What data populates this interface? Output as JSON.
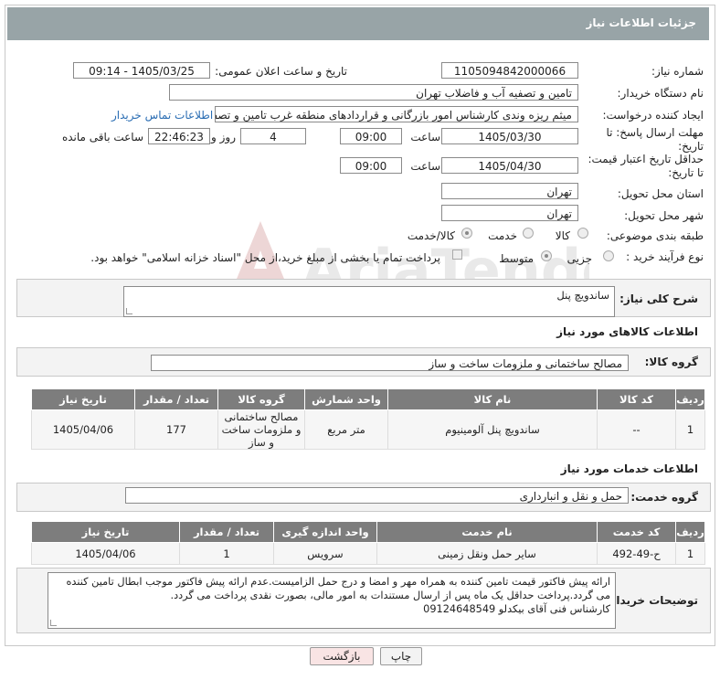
{
  "header": {
    "title": "جزئیات اطلاعات نیاز"
  },
  "fields": {
    "need_number_label": "شماره نیاز:",
    "need_number": "1105094842000066",
    "announce_label": "تاریخ و ساعت اعلان عمومی:",
    "announce_value": "1405/03/25 - 09:14",
    "buyer_org_label": "نام دستگاه خریدار:",
    "buyer_org": "تامین و تصفیه آب و فاضلاب تهران",
    "requester_label": "ایجاد کننده درخواست:",
    "requester": "میثم ریزه وندی کارشناس امور بازرگانی و قراردادهای منطقه غرب تامین و تصفیه",
    "contact_link": "اطلاعات تماس خریدار",
    "deadline_label": "مهلت ارسال پاسخ: تا تاریخ:",
    "deadline_date": "1405/03/30",
    "time_label": "ساعت",
    "deadline_time": "09:00",
    "days": "4",
    "days_label": "روز و",
    "remaining_time": "22:46:23",
    "remaining_label": "ساعت باقی مانده",
    "validity_label": "حداقل تاریخ اعتبار قیمت: تا تاریخ:",
    "validity_date": "1405/04/30",
    "validity_time": "09:00",
    "province_label": "استان محل تحویل:",
    "province": "تهران",
    "city_label": "شهر محل تحویل:",
    "city": "تهران",
    "category_label": "طبقه بندی موضوعی:",
    "category_options": [
      "کالا",
      "خدمت",
      "کالا/خدمت"
    ],
    "process_label": "نوع فرآیند خرید :",
    "process_options": [
      "جزیی",
      "متوسط"
    ],
    "payment_note": "پرداخت تمام یا بخشی از مبلغ خرید،از محل \"اسناد خزانه اسلامی\" خواهد بود."
  },
  "description": {
    "label": "شرح کلی نیاز:",
    "value": "ساندویچ پنل"
  },
  "goods": {
    "section_title": "اطلاعات کالاهای مورد نیاز",
    "group_label": "گروه کالا:",
    "group_value": "مصالح ساختمانی و ملزومات ساخت و ساز",
    "columns": [
      "ردیف",
      "کد کالا",
      "نام کالا",
      "واحد شمارش",
      "گروه کالا",
      "تعداد / مقدار",
      "تاریخ نیاز"
    ],
    "rows": [
      {
        "row": "1",
        "code": "--",
        "name": "ساندویچ پنل آلومینیوم",
        "unit": "متر مربع",
        "group": "مصالح ساختمانی و ملزومات ساخت و ساز",
        "qty": "177",
        "date": "1405/04/06"
      }
    ]
  },
  "services": {
    "section_title": "اطلاعات خدمات مورد نیاز",
    "group_label": "گروه خدمت:",
    "group_value": "حمل و نقل و انبارداری",
    "columns": [
      "ردیف",
      "کد خدمت",
      "نام خدمت",
      "واحد اندازه گیری",
      "تعداد / مقدار",
      "تاریخ نیاز"
    ],
    "rows": [
      {
        "row": "1",
        "code": "ح-49-492",
        "name": "سایر حمل ونقل زمینی",
        "unit": "سرویس",
        "qty": "1",
        "date": "1405/04/06"
      }
    ]
  },
  "buyer_notes": {
    "label": "توضیحات خریدار:",
    "line1": "ارائه پیش فاکتور قیمت تامین کننده به همراه مهر و امضا و درج حمل الزامیست.عدم ارائه پیش فاکتور موجب ابطال تامین کننده",
    "line2": "می گردد.پرداخت حداقل یک ماه پس از ارسال مستندات به امور مالی، بصورت نقدی پرداخت می گردد.",
    "line3": "کارشناس فنی آقای بیکدلو 09124648549"
  },
  "buttons": {
    "print": "چاپ",
    "back": "بازگشت"
  },
  "watermark": "AriaTender.neT",
  "colors": {
    "header_bg": "#98a4a7",
    "table_header_bg": "#7d7d7d",
    "link": "#2a6db3",
    "back_button_bg": "#f9e4e4"
  }
}
